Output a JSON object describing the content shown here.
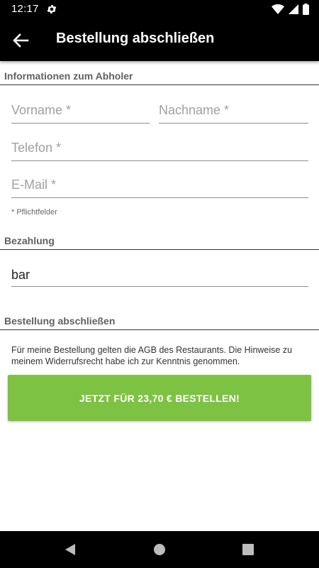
{
  "status_bar": {
    "time": "12:17",
    "icons": [
      "gear-icon",
      "wifi-icon",
      "signal-icon",
      "battery-icon"
    ]
  },
  "app_bar": {
    "back_icon": "arrow-left-icon",
    "title": "Bestellung abschließen"
  },
  "pickup_section": {
    "title": "Informationen zum Abholer",
    "first_name": {
      "value": "",
      "placeholder": "Vorname *"
    },
    "last_name": {
      "value": "",
      "placeholder": "Nachname *"
    },
    "phone": {
      "value": "",
      "placeholder": "Telefon *"
    },
    "email": {
      "value": "",
      "placeholder": "E-Mail *"
    },
    "required_hint": "* Pflichtfelder"
  },
  "payment_section": {
    "title": "Bezahlung",
    "selected_method": "bar"
  },
  "checkout_section": {
    "title": "Bestellung abschließen",
    "terms_text": "Für meine Bestellung gelten die AGB des Restaurants. Die Hinweise zu meinem Widerrufsrecht habe ich zur Kenntnis genommen.",
    "order_button_label": "JETZT FÜR 23,70 € BESTELLEN!"
  },
  "colors": {
    "bars": "#000000",
    "accent_button": "#7dc242",
    "section_title": "#616161"
  },
  "nav_bar": {
    "icons": [
      "back-triangle-icon",
      "home-circle-icon",
      "recents-square-icon"
    ]
  }
}
